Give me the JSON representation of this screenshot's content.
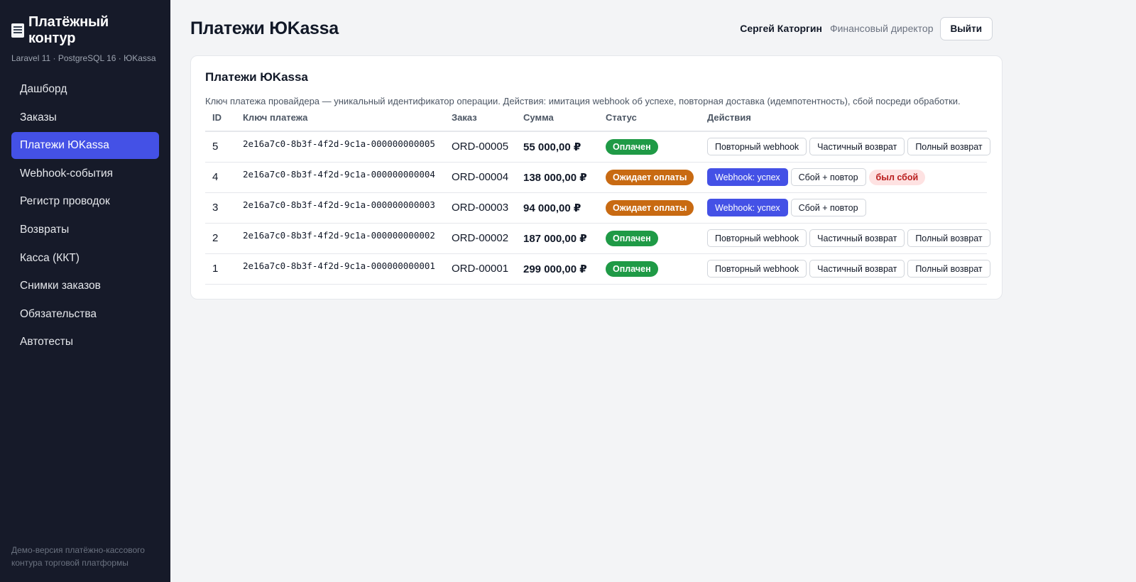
{
  "sidebar": {
    "brand_title": "Платёжный контур",
    "brand_sub": "Laravel 11 · PostgreSQL 16 · ЮKassa",
    "items": [
      {
        "label": "Дашборд"
      },
      {
        "label": "Заказы"
      },
      {
        "label": "Платежи ЮKassa",
        "active": true
      },
      {
        "label": "Webhook-события"
      },
      {
        "label": "Регистр проводок"
      },
      {
        "label": "Возвраты"
      },
      {
        "label": "Касса (ККТ)"
      },
      {
        "label": "Снимки заказов"
      },
      {
        "label": "Обязательства"
      },
      {
        "label": "Автотесты"
      }
    ],
    "footer": "Демо-версия платёжно-кассового контура торговой платформы"
  },
  "header": {
    "title": "Платежи ЮKassa",
    "user_name": "Сергей Каторгин",
    "user_role": "Финансовый директор",
    "logout_label": "Выйти"
  },
  "card": {
    "title": "Платежи ЮKassa",
    "description": "Ключ платежа провайдера — уникальный идентификатор операции. Действия: имитация webhook об успехе, повторная доставка (идемпотентность), сбой посреди обработки.",
    "columns": [
      "ID",
      "Ключ платежа",
      "Заказ",
      "Сумма",
      "Статус",
      "Действия"
    ],
    "rows": [
      {
        "id": "5",
        "key": "2e16a7c0-8b3f-4f2d-9c1a-000000000005",
        "order": "ORD-00005",
        "amount": "55 000,00 ₽",
        "status": "Оплачен",
        "status_kind": "paid",
        "actions": [
          "Повторный webhook",
          "Частичный возврат",
          "Полный возврат"
        ],
        "tag": ""
      },
      {
        "id": "4",
        "key": "2e16a7c0-8b3f-4f2d-9c1a-000000000004",
        "order": "ORD-00004",
        "amount": "138 000,00 ₽",
        "status": "Ожидает оплаты",
        "status_kind": "waiting",
        "actions": [
          "Webhook: успех",
          "Сбой + повтор"
        ],
        "tag": "был сбой"
      },
      {
        "id": "3",
        "key": "2e16a7c0-8b3f-4f2d-9c1a-000000000003",
        "order": "ORD-00003",
        "amount": "94 000,00 ₽",
        "status": "Ожидает оплаты",
        "status_kind": "waiting",
        "actions": [
          "Webhook: успех",
          "Сбой + повтор"
        ],
        "tag": ""
      },
      {
        "id": "2",
        "key": "2e16a7c0-8b3f-4f2d-9c1a-000000000002",
        "order": "ORD-00002",
        "amount": "187 000,00 ₽",
        "status": "Оплачен",
        "status_kind": "paid",
        "actions": [
          "Повторный webhook",
          "Частичный возврат",
          "Полный возврат"
        ],
        "tag": ""
      },
      {
        "id": "1",
        "key": "2e16a7c0-8b3f-4f2d-9c1a-000000000001",
        "order": "ORD-00001",
        "amount": "299 000,00 ₽",
        "status": "Оплачен",
        "status_kind": "paid",
        "actions": [
          "Повторный webhook",
          "Частичный возврат",
          "Полный возврат"
        ],
        "tag": ""
      }
    ]
  },
  "colors": {
    "sidebar_bg": "#161a29",
    "accent": "#4451e6",
    "paid": "#1f9a46",
    "waiting": "#c86a12",
    "fail_bg": "#fee2e2",
    "fail_text": "#b91c1c"
  },
  "icons": {
    "brand": "receipt-icon"
  }
}
